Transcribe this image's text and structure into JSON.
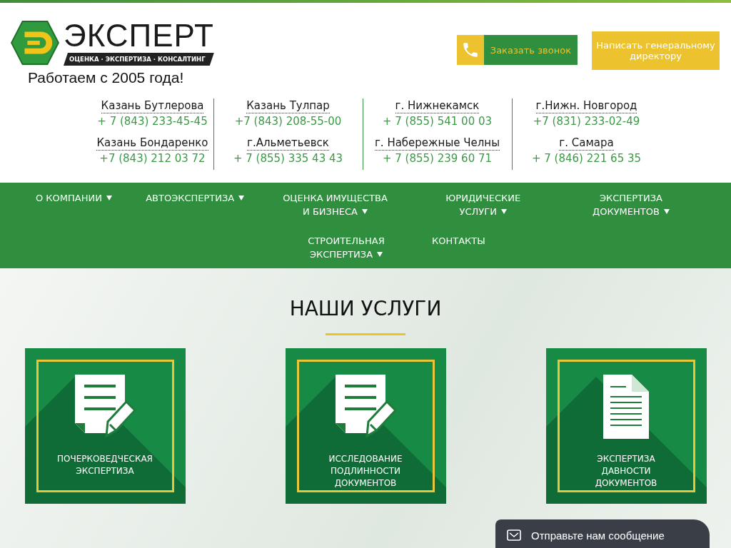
{
  "logo": {
    "name": "ЭКСПЕРТ",
    "tagline": "ОЦЕНКА · ЭКСПЕРТИЗА · КОНСАЛТИНГ",
    "since": "Работаем с 2005 года!"
  },
  "buttons": [
    {
      "label": "Заказать звонок",
      "kind": "call"
    },
    {
      "label": "Написать генеральному директору",
      "kind": "plain"
    }
  ],
  "offices": [
    [
      {
        "city": "Казань Бутлерова",
        "phone": "+ 7 (843) 233-45-45"
      },
      {
        "city": "Казань Бондаренко",
        "phone": "+7 (843) 212 03 72"
      }
    ],
    [
      {
        "city": "Казань Тулпар",
        "phone": "+7 (843) 208-55-00"
      },
      {
        "city": "г.Альметьевск",
        "phone": "+ 7 (855) 335 43 43"
      }
    ],
    [
      {
        "city": "г. Нижнекамск",
        "phone": "+ 7 (855) 541 00 03"
      },
      {
        "city": "г. Набережные Челны",
        "phone": "+ 7 (855) 239 60 71"
      }
    ],
    [
      {
        "city": "г.Нижн. Новгород",
        "phone": "+7 (831) 233-02-49"
      },
      {
        "city": "г. Самара",
        "phone": "+ 7 (846) 221 65 35"
      }
    ]
  ],
  "nav": [
    {
      "label": "О КОМПАНИИ",
      "dropdown": true
    },
    {
      "label": "АВТОЭКСПЕРТИЗА",
      "dropdown": true
    },
    {
      "label": "ОЦЕНКА ИМУЩЕСТВА И БИЗНЕСА",
      "dropdown": true
    },
    {
      "label": "ЮРИДИЧЕСКИЕ УСЛУГИ",
      "dropdown": true
    },
    {
      "label": "ЭКСПЕРТИЗА ДОКУМЕНТОВ",
      "dropdown": true
    },
    {
      "label": "СТРОИТЕЛЬНАЯ ЭКСПЕРТИЗА",
      "dropdown": true
    },
    {
      "label": "КОНТАКТЫ",
      "dropdown": false
    }
  ],
  "services": {
    "title": "НАШИ УСЛУГИ",
    "items": [
      {
        "label": "ПОЧЕРКОВЕДЧЕСКАЯ ЭКСПЕРТИЗА",
        "kind": "pencil"
      },
      {
        "label": "ИССЛЕДОВАНИЕ ПОДЛИННОСТИ ДОКУМЕНТОВ",
        "kind": "pencil"
      },
      {
        "label": "ЭКСПЕРТИЗА ДАВНОСТИ ДОКУМЕНТОВ",
        "kind": "document"
      }
    ]
  },
  "chat": {
    "label": "Отправьте нам сообщение"
  }
}
